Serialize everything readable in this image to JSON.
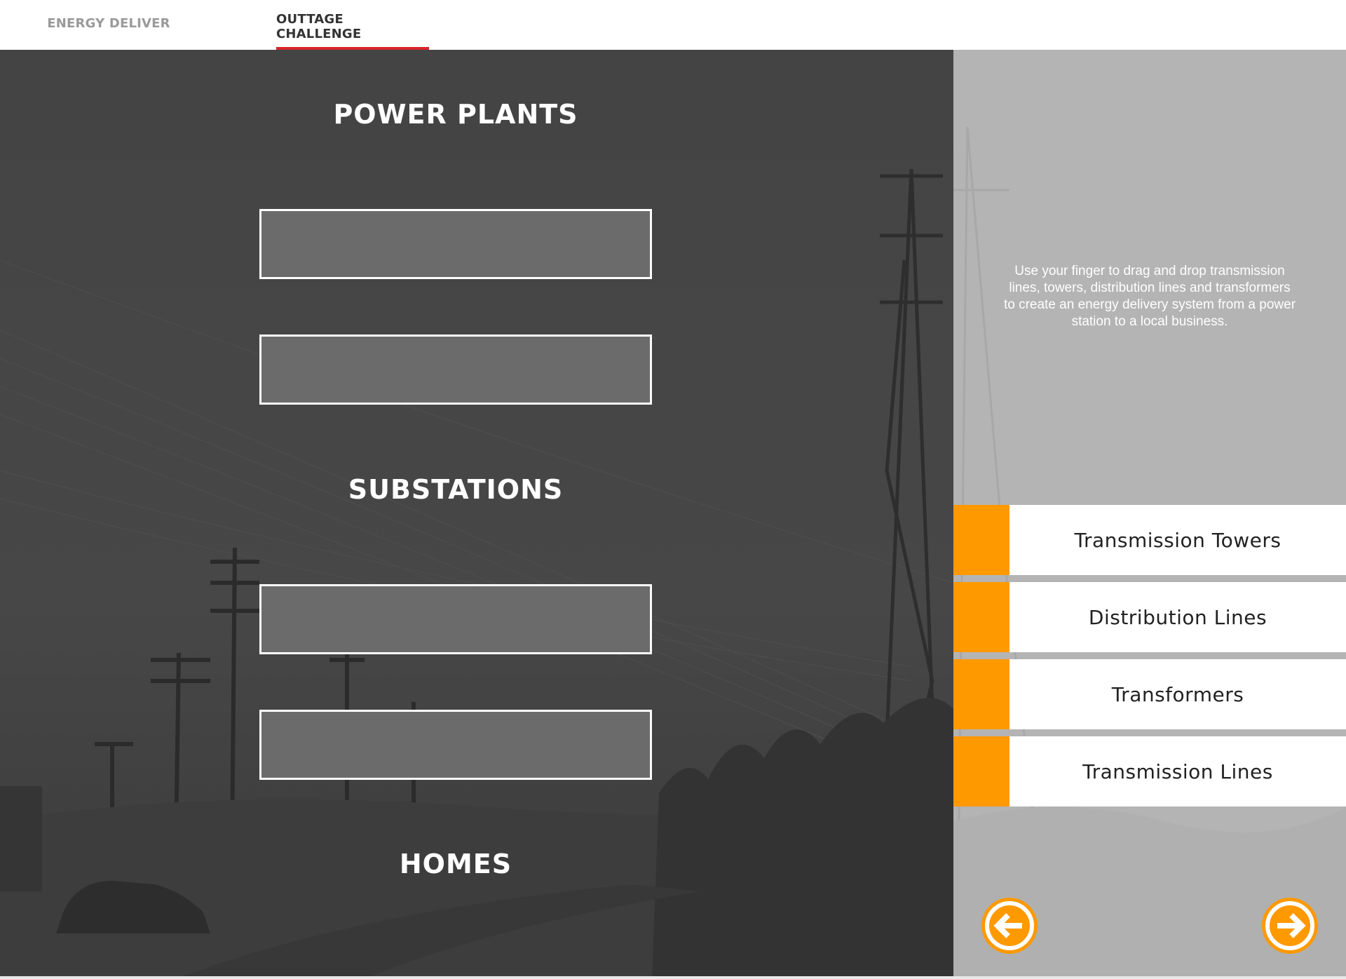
{
  "tabs": [
    {
      "label": "ENERGY DELIVER",
      "active": false
    },
    {
      "label": "OUTTAGE CHALLENGE",
      "active": true
    }
  ],
  "board": {
    "power_plants_title": "POWER PLANTS",
    "substations_title": "SUBSTATIONS",
    "homes_title": "HOMES"
  },
  "side": {
    "instructions": "Use your finger to drag and drop transmission lines, towers, distribution lines and transformers to create an energy delivery system from a power station to a local business.",
    "items": [
      {
        "label": "Transmission Towers"
      },
      {
        "label": "Distribution Lines"
      },
      {
        "label": "Transformers"
      },
      {
        "label": "Transmission Lines"
      }
    ]
  },
  "navigation": {
    "back_icon": "arrow-left-icon",
    "forward_icon": "arrow-right-icon"
  },
  "colors": {
    "accent": "#ff9900",
    "tab_underline": "#d6262b",
    "board_bg": "#434343",
    "slot_fill": "#6b6b6b",
    "side_bg": "#b4b4b4"
  }
}
